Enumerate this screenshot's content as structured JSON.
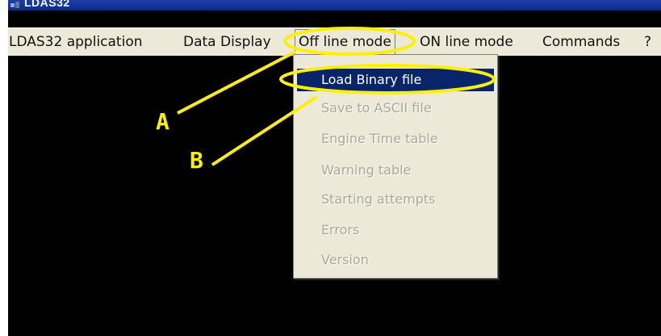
{
  "window": {
    "title": "LDAS32"
  },
  "menubar": {
    "items": [
      {
        "label": "LDAS32 application"
      },
      {
        "label": "Data Display"
      },
      {
        "label": "Off line mode"
      },
      {
        "label": "ON line mode"
      },
      {
        "label": "Commands"
      },
      {
        "label": "?"
      }
    ]
  },
  "offline_menu": {
    "items": [
      {
        "label": "Load Binary file",
        "state": "highlighted"
      },
      {
        "label": "Save to ASCII file",
        "state": "disabled"
      },
      {
        "label": "Engine Time table",
        "state": "disabled"
      },
      {
        "label": "Warning table",
        "state": "disabled"
      },
      {
        "label": "Starting attempts",
        "state": "disabled"
      },
      {
        "label": "Errors",
        "state": "disabled"
      },
      {
        "label": "Version",
        "state": "disabled"
      }
    ]
  },
  "annotations": {
    "a_label": "A",
    "b_label": "B",
    "color": "#ffef00"
  },
  "colors": {
    "menu_bg": "#ece9d8",
    "highlight_bg": "#0a246a",
    "disabled_text": "#aca899",
    "canvas_bg": "#000000"
  }
}
